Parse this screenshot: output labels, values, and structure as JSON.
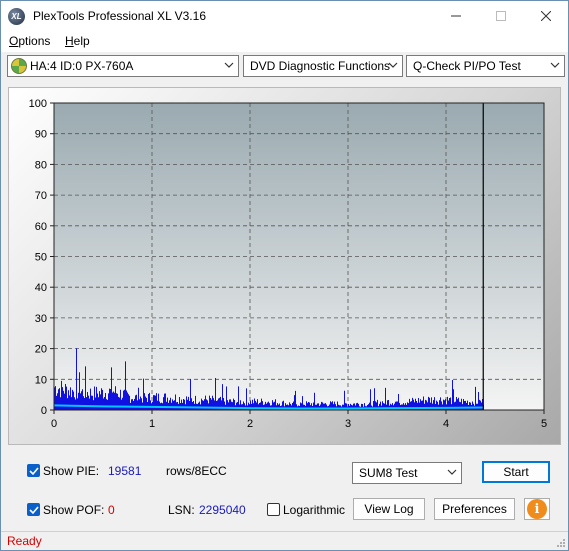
{
  "window": {
    "title": "PlexTools Professional XL V3.16",
    "app_icon_text": "XL"
  },
  "menu": [
    {
      "label": "Options"
    },
    {
      "label": "Help"
    }
  ],
  "toolbar": {
    "drive": "HA:4 ID:0  PX-760A",
    "function": "DVD Diagnostic Functions",
    "test": "Q-Check PI/PO Test"
  },
  "chart_data": {
    "type": "area",
    "x_ticks": [
      "0",
      "1",
      "2",
      "3",
      "4",
      "5"
    ],
    "y_ticks": [
      "0",
      "10",
      "20",
      "30",
      "40",
      "50",
      "60",
      "70",
      "80",
      "90",
      "100"
    ],
    "xlim": [
      0,
      5
    ],
    "ylim": [
      0,
      100
    ],
    "grid": true,
    "end_marker_x": 4.38,
    "series": [
      {
        "type": "bars",
        "color": "#1010e0",
        "x": [
          0.0,
          0.2,
          0.4,
          0.6,
          0.8,
          1.0,
          1.2,
          1.4,
          1.6,
          1.8,
          2.0,
          2.2,
          2.4,
          2.6,
          2.8,
          3.0,
          3.2,
          3.4,
          3.6,
          3.8,
          4.0,
          4.2,
          4.38
        ],
        "values": [
          11,
          9,
          8,
          9,
          6,
          6,
          6,
          5,
          5,
          4,
          4,
          4,
          3,
          3,
          3,
          3,
          3,
          4,
          4,
          5,
          5,
          4,
          4
        ]
      },
      {
        "type": "line",
        "color": "#00c8ff",
        "x": [
          0.0,
          0.5,
          1.0,
          1.5,
          2.0,
          2.5,
          3.0,
          3.5,
          4.0,
          4.38
        ],
        "values": [
          1.5,
          1.2,
          1.0,
          0.8,
          0.6,
          0.5,
          0.5,
          0.6,
          0.7,
          0.8
        ]
      }
    ],
    "colors": {
      "plot_bg_top": "#9aaab0",
      "plot_bg_bottom": "#f4f4f4",
      "grid": "#555555"
    }
  },
  "bottom": {
    "show_pie_label": "Show PIE:",
    "pie_value": "19581",
    "pie_unit": "rows/8ECC",
    "show_pof_label": "Show POF:",
    "pof_value": "0",
    "lsn_label": "LSN:",
    "lsn_value": "2295040",
    "logarithmic_label": "Logarithmic",
    "sum_select": "SUM8 Test",
    "start_label": "Start",
    "view_log_label": "View Log",
    "preferences_label": "Preferences",
    "info_label": "i"
  },
  "status": {
    "text": "Ready"
  }
}
